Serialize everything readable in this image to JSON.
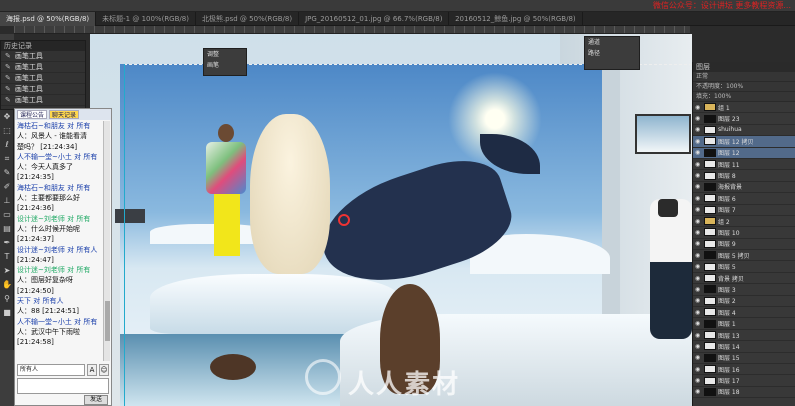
{
  "top_watermark": "微信公众号：设计讲坛 更多教程资源...",
  "tabs": [
    {
      "label": "海报.psd @ 50%(RGB/8)",
      "active": true
    },
    {
      "label": "未标题-1 @ 100%(RGB/8)",
      "active": false
    },
    {
      "label": "北极熊.psd @ 50%(RGB/8)",
      "active": false
    },
    {
      "label": "JPG_20160512_01.jpg @ 66.7%(RGB/8)",
      "active": false
    },
    {
      "label": "20160512_鲸鱼.jpg @ 50%(RGB/8)",
      "active": false
    }
  ],
  "history": {
    "title": "历史记录",
    "items": [
      "画笔工具",
      "画笔工具",
      "画笔工具",
      "画笔工具",
      "画笔工具"
    ]
  },
  "chat": {
    "tabs": [
      "课程公告",
      "聊天记录"
    ],
    "messages": [
      {
        "cls": "n",
        "text": "海枯石~和朋友 对 所有"
      },
      {
        "cls": "t",
        "text": "人：风景人 - 谁能看清"
      },
      {
        "cls": "t",
        "text": "楚吗？   [21:24:34]"
      },
      {
        "cls": "n",
        "text": "人不输一堂~小土 对 所有"
      },
      {
        "cls": "t",
        "text": "人：今天人真多了"
      },
      {
        "cls": "t",
        "text": "[21:24:35]"
      },
      {
        "cls": "n",
        "text": "海枯石~和朋友 对 所有"
      },
      {
        "cls": "t",
        "text": "人：主要都要那么好"
      },
      {
        "cls": "t",
        "text": "[21:24:36]"
      },
      {
        "cls": "g",
        "text": "设计迷~刘老师 对 所有"
      },
      {
        "cls": "t",
        "text": "人：什么时候开始呢"
      },
      {
        "cls": "t",
        "text": "   [21:24:37]"
      },
      {
        "cls": "n",
        "text": "设计迷~刘老师 对 所有人"
      },
      {
        "cls": "t",
        "text": "[21:24:47]"
      },
      {
        "cls": "g",
        "text": "设计迷~刘老师 对 所有"
      },
      {
        "cls": "t",
        "text": "人：图层好复杂呀"
      },
      {
        "cls": "t",
        "text": "[21:24:50]"
      },
      {
        "cls": "n",
        "text": "天下 对 所有人"
      },
      {
        "cls": "t",
        "text": "人：88 [21:24:51]"
      },
      {
        "cls": "n",
        "text": "人不输一堂~小土 对 所有"
      },
      {
        "cls": "t",
        "text": "人：武汉中午下雨啦"
      },
      {
        "cls": "t",
        "text": "[21:24:58]"
      }
    ],
    "recipient": "所有人",
    "send_label": "发送"
  },
  "mini_panels": {
    "left": [
      "调整",
      "画笔"
    ],
    "right": [
      "通道",
      "路径"
    ]
  },
  "layers": {
    "title": "图层",
    "blend": "正常",
    "opacity_label": "不透明度：100%",
    "fill_label": "填充：100%",
    "items": [
      {
        "name": "组 1",
        "sel": false,
        "group": true
      },
      {
        "name": "图层 23",
        "sel": false,
        "group": false
      },
      {
        "name": "shuihua",
        "sel": false,
        "group": false
      },
      {
        "name": "图层 12 拷贝",
        "sel": true,
        "group": false
      },
      {
        "name": "图层 12",
        "sel": true,
        "group": false
      },
      {
        "name": "图层 11",
        "sel": false,
        "group": false
      },
      {
        "name": "图层 8",
        "sel": false,
        "group": false
      },
      {
        "name": "海报背景",
        "sel": false,
        "group": false
      },
      {
        "name": "图层 6",
        "sel": false,
        "group": false
      },
      {
        "name": "图层 7",
        "sel": false,
        "group": false
      },
      {
        "name": "组 2",
        "sel": false,
        "group": true
      },
      {
        "name": "图层 10",
        "sel": false,
        "group": false
      },
      {
        "name": "图层 9",
        "sel": false,
        "group": false
      },
      {
        "name": "图层 5 拷贝",
        "sel": false,
        "group": false
      },
      {
        "name": "图层 5",
        "sel": false,
        "group": false
      },
      {
        "name": "背景 拷贝",
        "sel": false,
        "group": false
      },
      {
        "name": "图层 3",
        "sel": false,
        "group": false
      },
      {
        "name": "图层 2",
        "sel": false,
        "group": false
      },
      {
        "name": "图层 4",
        "sel": false,
        "group": false
      },
      {
        "name": "图层 1",
        "sel": false,
        "group": false
      },
      {
        "name": "图层 13",
        "sel": false,
        "group": false
      },
      {
        "name": "图层 14",
        "sel": false,
        "group": false
      },
      {
        "name": "图层 15",
        "sel": false,
        "group": false
      },
      {
        "name": "图层 16",
        "sel": false,
        "group": false
      },
      {
        "name": "图层 17",
        "sel": false,
        "group": false
      },
      {
        "name": "图层 18",
        "sel": false,
        "group": false
      }
    ]
  },
  "canvas_watermark": "人人素材",
  "colors": {
    "selection": "#526a8a",
    "panel": "#383838",
    "accent_red": "#dd2222"
  }
}
